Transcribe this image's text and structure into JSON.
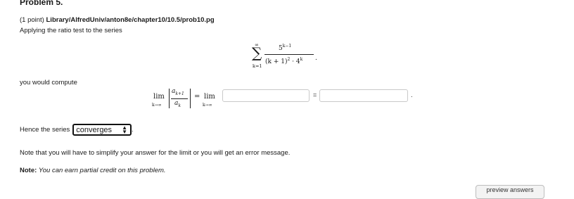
{
  "problem": {
    "heading": "Problem 5.",
    "points": "(1 point)",
    "path": "Library/AlfredUniv/anton8e/chapter10/10.5/prob10.pg",
    "intro": "Applying the ratio test to the series"
  },
  "series": {
    "sum_upper": "∞",
    "sum_symbol": "∑",
    "sum_lower": "k=1",
    "numerator": "5",
    "numerator_exp": "k−1",
    "den_base": "(k + 1)",
    "den_exp1": "2",
    "den_dot": "· 4",
    "den_exp2": "k",
    "trailing": "."
  },
  "compute": {
    "text": "you would compute",
    "lim": "lim",
    "lim_sub": "k→∞",
    "ratio_num": "a",
    "ratio_num_sub": "k+1",
    "ratio_den": "a",
    "ratio_den_sub": "k",
    "equals": "=",
    "equals2": "=",
    "period": ".",
    "input1_value": "",
    "input2_value": ""
  },
  "hence": {
    "prefix": "Hence the series",
    "select_value": "converges",
    "suffix": "."
  },
  "notes": {
    "simplify": "Note that you will have to simplify your answer for the limit or you will get an error message.",
    "note_label": "Note:",
    "partial": "You can earn partial credit on this problem."
  },
  "buttons": {
    "preview": "preview answers"
  }
}
